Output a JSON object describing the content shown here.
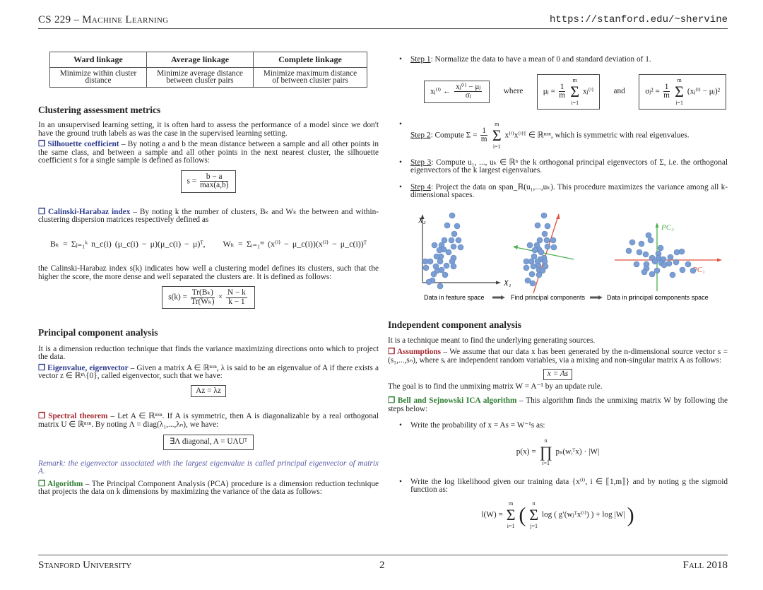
{
  "header": {
    "course": "CS 229 – Machine Learning",
    "url": "https://stanford.edu/~shervine"
  },
  "footer": {
    "left": "Stanford University",
    "page": "2",
    "right": "Fall 2018"
  },
  "linkage_table": {
    "headers": [
      "Ward linkage",
      "Average linkage",
      "Complete linkage"
    ],
    "rows": [
      [
        "Minimize within cluster distance",
        "Minimize average distance between cluster pairs",
        "Minimize maximum distance of between cluster pairs"
      ]
    ]
  },
  "clustering_metrics": {
    "title": "Clustering assessment metrics",
    "intro": "In an unsupervised learning setting, it is often hard to assess the performance of a model since we don't have the ground truth labels as was the case in the supervised learning setting.",
    "silhouette": {
      "term": "❒ Silhouette coefficient",
      "text": " – By noting a and b the mean distance between a sample and all other points in the same class, and between a sample and all other points in the next nearest cluster, the silhouette coefficient s for a single sample is defined as follows:",
      "formula_lhs": "s =",
      "formula_num": "b − a",
      "formula_den": "max(a,b)"
    },
    "calinski": {
      "term": "❒ Calinski-Harabaz index",
      "text": " – By noting k the number of clusters, Bₖ and Wₖ the between and within-clustering dispersion matrices respectively defined as",
      "bk_formula": "Bₖ = Σⱼ₌₁ᵏ n_c(i) (μ_c(i) − μ)(μ_c(i) − μ)ᵀ,",
      "wk_formula": "Wₖ = Σᵢ₌₁ᵐ (x⁽ⁱ⁾ − μ_c(i))(x⁽ⁱ⁾ − μ_c(i))ᵀ",
      "text2": "the Calinski-Harabaz index s(k) indicates how well a clustering model defines its clusters, such that the higher the score, the more dense and well separated the clusters are. It is defined as follows:",
      "formula_lhs": "s(k) =",
      "formula_num1": "Tr(Bₖ)",
      "formula_den1": "Tr(Wₖ)",
      "formula_times": "×",
      "formula_num2": "N − k",
      "formula_den2": "k − 1"
    }
  },
  "pca": {
    "title": "Principal component analysis",
    "intro": "It is a dimension reduction technique that finds the variance maximizing directions onto which to project the data.",
    "eigen": {
      "term": "❒ Eigenvalue, eigenvector",
      "text": " – Given a matrix A ∈ ℝⁿˣⁿ, λ is said to be an eigenvalue of A if there exists a vector z ∈ ℝⁿ\\{0}, called eigenvector, such that we have:",
      "formula": "Az = λz"
    },
    "spectral": {
      "term": "❒ Spectral theorem",
      "text": " – Let A ∈ ℝⁿˣⁿ. If A is symmetric, then A is diagonalizable by a real orthogonal matrix U ∈ ℝⁿˣⁿ. By noting Λ = diag(λ₁,...,λₙ), we have:",
      "formula": "∃Λ diagonal,   A = UΛUᵀ"
    },
    "remark": "Remark: the eigenvector associated with the largest eigenvalue is called principal eigenvector of matrix A.",
    "algorithm": {
      "term": "❒ Algorithm",
      "text": " – The Principal Component Analysis (PCA) procedure is a dimension reduction technique that projects the data on k dimensions by maximizing the variance of the data as follows:"
    },
    "steps": [
      {
        "label": "Step 1",
        "text": ": Normalize the data to have a mean of 0 and standard deviation of 1."
      },
      {
        "label": "Step 2",
        "text_pre": ": Compute Σ = ",
        "text_post": " x⁽ⁱ⁾x⁽ⁱ⁾ᵀ ∈ ℝⁿˣⁿ, which is symmetric with real eigenvalues."
      },
      {
        "label": "Step 3",
        "text": ": Compute u₁, ..., uₖ ∈ ℝⁿ the k orthogonal principal eigenvectors of Σ, i.e. the orthogonal eigenvectors of the k largest eigenvalues."
      },
      {
        "label": "Step 4",
        "text": ": Project the data on span_ℝ(u₁,...,uₖ). This procedure maximizes the variance among all k-dimensional spaces."
      }
    ],
    "step1_formulas": {
      "f1_lhs": "xⱼ⁽ⁱ⁾ ←",
      "f1_num": "xⱼ⁽ⁱ⁾ − μⱼ",
      "f1_den": "σⱼ",
      "where": "where",
      "f2_lhs": "μⱼ =",
      "f2_rhs": "xⱼ⁽ⁱ⁾",
      "and": "and",
      "f3_lhs": "σⱼ² =",
      "f3_rhs": "(xⱼ⁽ⁱ⁾ − μⱼ)²",
      "frac_num": "1",
      "frac_den": "m",
      "sum_top": "m",
      "sum_bot": "i=1"
    },
    "figure": {
      "axis_x": "X₁",
      "axis_y": "X₂",
      "pc1": "PC₁",
      "pc2": "PC₂",
      "caption1": "Data in feature space",
      "caption2": "Find principal components",
      "caption3_pre": "Data in ",
      "caption3_b1": "p",
      "caption3_mid": "rincipal ",
      "caption3_b2": "c",
      "caption3_post": "omponents space",
      "point_color": "#7b9fd4",
      "pc1_color": "#e0503c",
      "pc2_color": "#4caf50"
    }
  },
  "ica": {
    "title": "Independent component analysis",
    "intro": "It is a technique meant to find the underlying generating sources.",
    "assumptions": {
      "term": "❒ Assumptions",
      "text": " – We assume that our data x has been generated by the n-dimensional source vector s = (s₁,...,sₙ), where sᵢ are independent random variables, via a mixing and non-singular matrix A as follows:",
      "formula": "x = As",
      "goal": "The goal is to find the unmixing matrix W = A⁻¹ by an update rule."
    },
    "bell": {
      "term": "❒ Bell and Sejnowski ICA algorithm",
      "text": " – This algorithm finds the unmixing matrix W by following the steps below:",
      "bullet1": "Write the probability of x = As = W⁻¹s as:",
      "formula1_lhs": "p(x) =",
      "formula1_op": "∏",
      "formula1_top": "n",
      "formula1_bot": "i=1",
      "formula1_rhs": "pₛ(wᵢᵀx) · |W|",
      "bullet2": "Write the log likelihood given our training data {x⁽ⁱ⁾, i ∈ ⟦1,m⟧} and by noting g the sigmoid function as:",
      "formula2_lhs": "l(W) =",
      "formula2_top1": "m",
      "formula2_bot1": "i=1",
      "formula2_top2": "n",
      "formula2_bot2": "j=1",
      "formula2_rhs": "log ( g′(wⱼᵀx⁽ⁱ⁾) ) + log |W|"
    }
  }
}
